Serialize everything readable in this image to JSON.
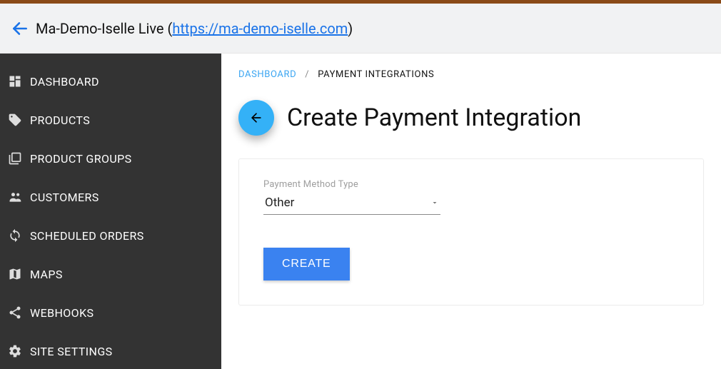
{
  "header": {
    "site_name": "Ma-Demo-Iselle Live",
    "site_link": "https://ma-demo-iselle.com"
  },
  "sidebar": {
    "items": [
      {
        "label": "DASHBOARD",
        "icon": "dashboard-icon"
      },
      {
        "label": "PRODUCTS",
        "icon": "tag-icon"
      },
      {
        "label": "PRODUCT GROUPS",
        "icon": "library-icon"
      },
      {
        "label": "CUSTOMERS",
        "icon": "group-icon"
      },
      {
        "label": "SCHEDULED ORDERS",
        "icon": "update-icon"
      },
      {
        "label": "MAPS",
        "icon": "map-icon"
      },
      {
        "label": "WEBHOOKS",
        "icon": "share-icon"
      },
      {
        "label": "SITE SETTINGS",
        "icon": "gear-icon"
      }
    ]
  },
  "breadcrumb": {
    "link": "DASHBOARD",
    "separator": "/",
    "current": "PAYMENT INTEGRATIONS"
  },
  "page": {
    "title": "Create Payment Integration"
  },
  "form": {
    "field_label": "Payment Method Type",
    "selected": "Other",
    "submit_label": "CREATE"
  }
}
